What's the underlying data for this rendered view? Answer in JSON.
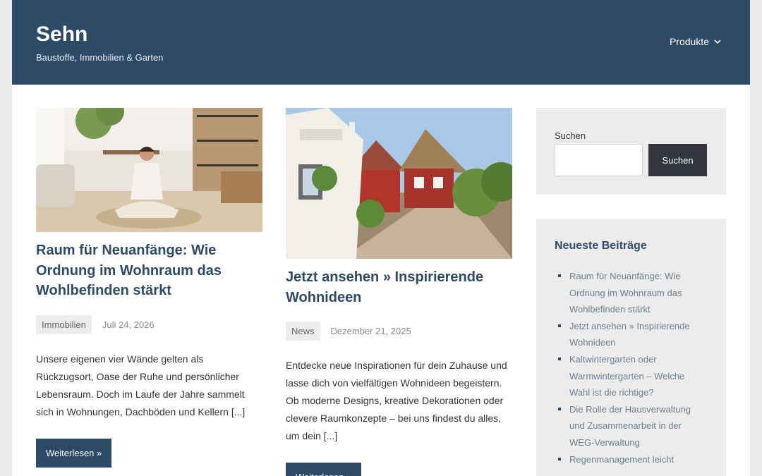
{
  "header": {
    "site_title": "Sehn",
    "tagline": "Baustoffe, Immobilien & Garten",
    "nav": {
      "produkte_label": "Produkte"
    }
  },
  "posts": [
    {
      "title": "Raum für Neuanfänge: Wie Ordnung im Wohnraum das Wohlbefinden stärkt",
      "category": "Immobilien",
      "date": "Juli 24, 2026",
      "excerpt": "Unsere eigenen vier Wände gelten als Rückzugsort, Oase der Ruhe und persönlicher Lebensraum. Doch im Laufe der Jahre sammelt sich in Wohnungen, Dachböden und Kellern [...]",
      "read_more": "Weiterlesen »"
    },
    {
      "title": "Jetzt ansehen » Inspirierende Wohnideen",
      "category": "News",
      "date": "Dezember 21, 2025",
      "excerpt": "Entdecke neue Inspirationen für dein Zuhause und lasse dich von vielfältigen Wohnideen begeistern. Ob moderne Designs, kreative Dekorationen oder clevere Raumkonzepte – bei uns findest du alles, um dein [...]",
      "read_more": "Weiterlesen »"
    }
  ],
  "sidebar": {
    "search": {
      "label": "Suchen",
      "input_value": "",
      "button_label": "Suchen"
    },
    "recent": {
      "title": "Neueste Beiträge",
      "items": [
        "Raum für Neuanfänge: Wie Ordnung im Wohnraum das Wohlbefinden stärkt",
        "Jetzt ansehen » Inspirierende Wohnideen",
        "Kaltwintergarten oder Warmwintergarten – Welche Wahl ist die richtige?",
        "Die Rolle der Hausverwaltung und Zusammenarbeit in der WEG-Verwaltung",
        "Regenmanagement leicht"
      ]
    }
  },
  "icons": {
    "nav_dropdown": "chevron-down-icon"
  },
  "colors": {
    "header_bg": "#2d4a66",
    "accent": "#2d4a66",
    "search_button": "#33373d"
  }
}
